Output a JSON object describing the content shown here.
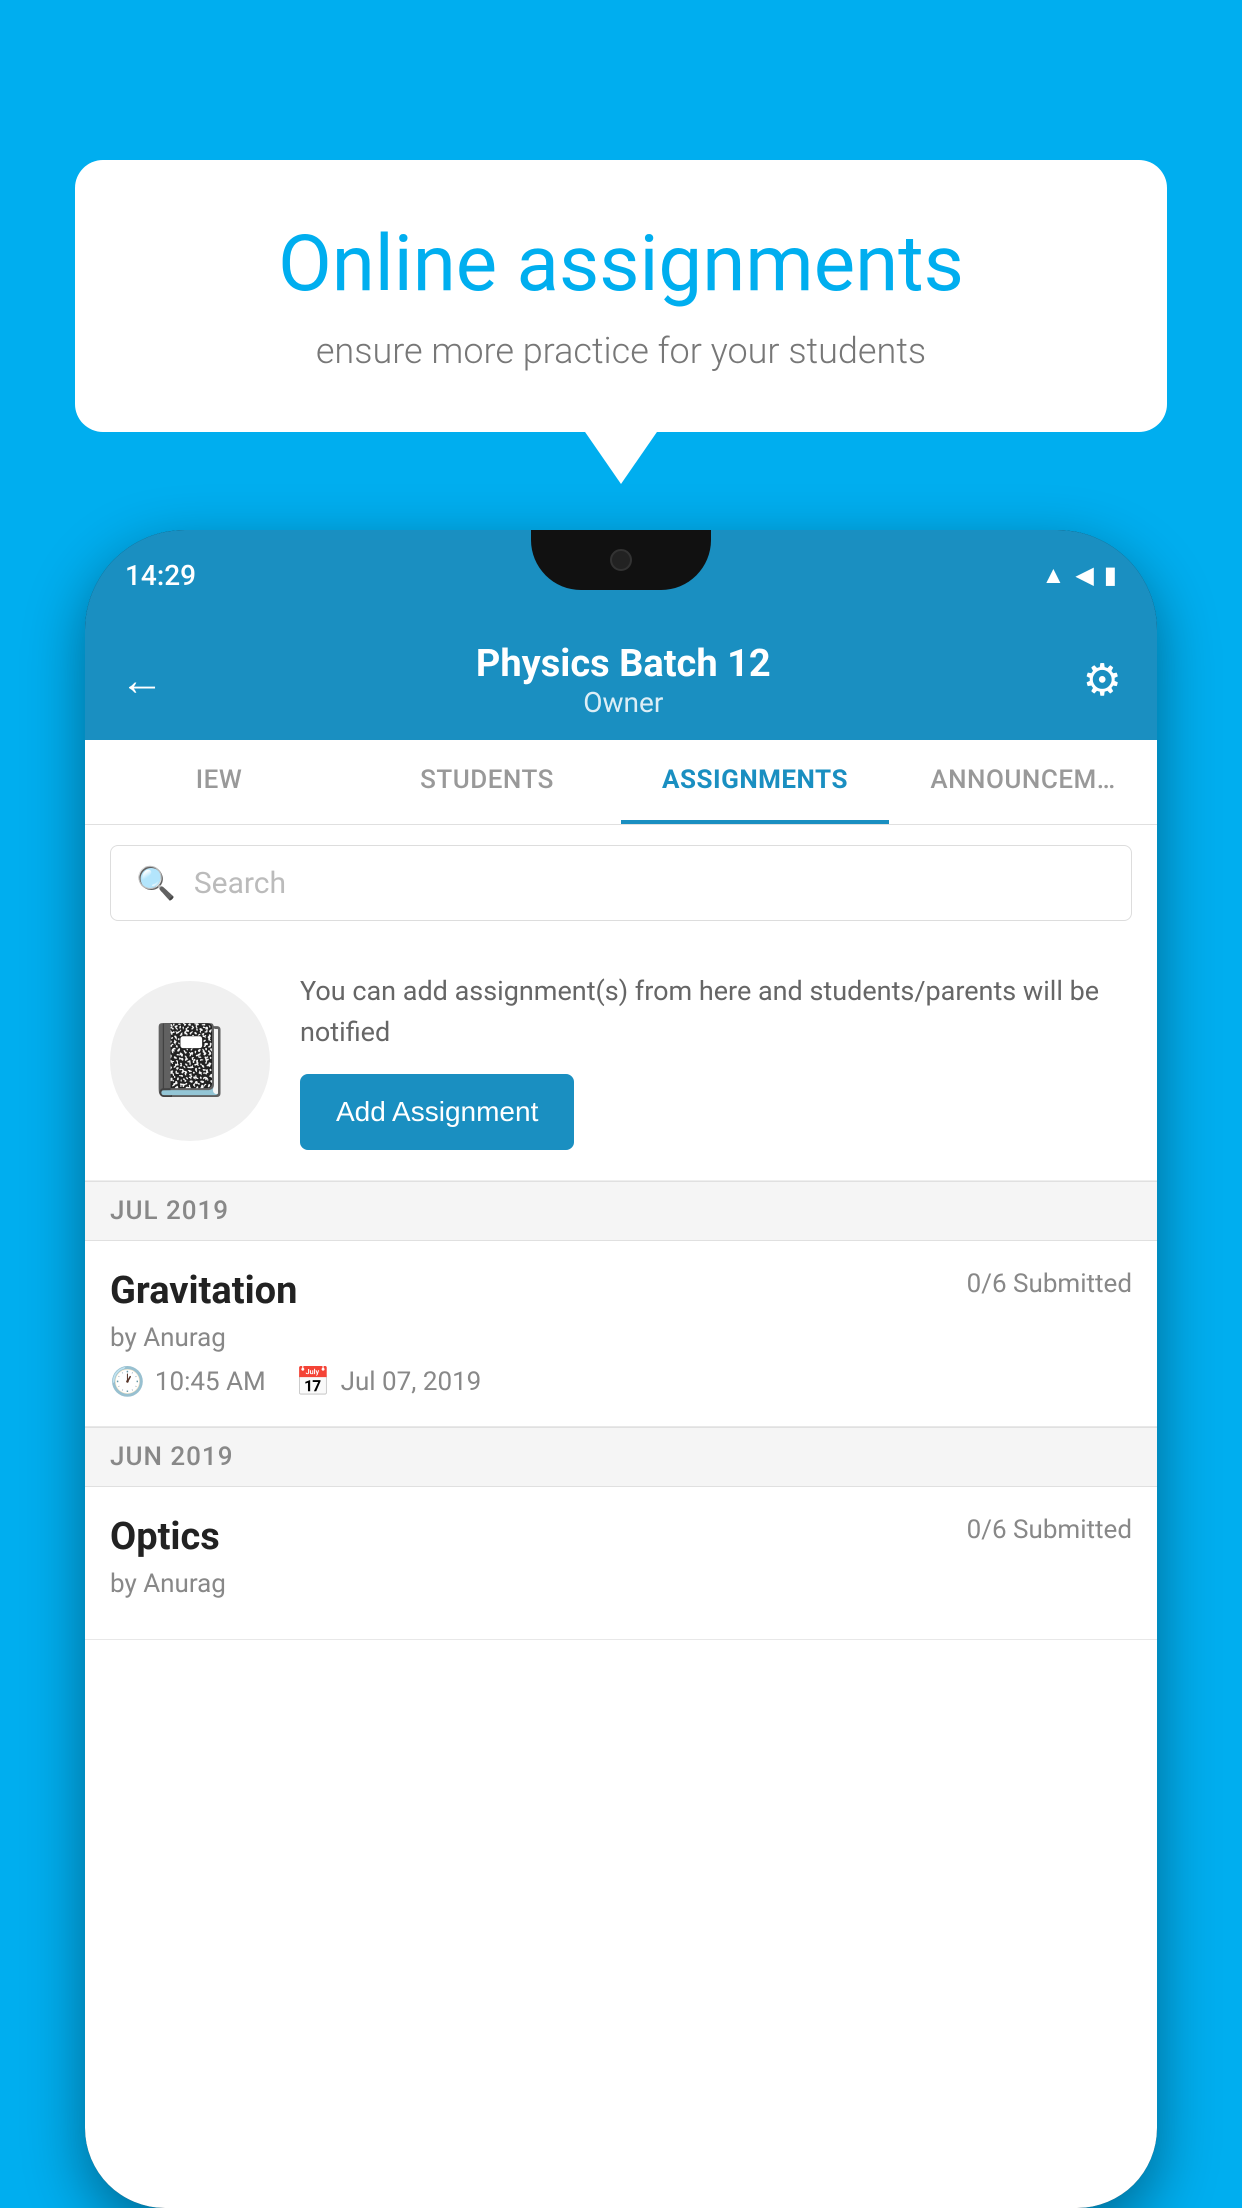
{
  "background_color": "#00AEEF",
  "speech_bubble": {
    "title": "Online assignments",
    "subtitle": "ensure more practice for your students"
  },
  "phone": {
    "time": "14:29",
    "header": {
      "title": "Physics Batch 12",
      "subtitle": "Owner",
      "back_label": "←",
      "settings_label": "⚙"
    },
    "tabs": [
      {
        "label": "IEW",
        "active": false
      },
      {
        "label": "STUDENTS",
        "active": false
      },
      {
        "label": "ASSIGNMENTS",
        "active": true
      },
      {
        "label": "ANNOUNCEM…",
        "active": false
      }
    ],
    "search": {
      "placeholder": "Search"
    },
    "promo": {
      "text": "You can add assignment(s) from here and students/parents will be notified",
      "button_label": "Add Assignment"
    },
    "sections": [
      {
        "header": "JUL 2019",
        "assignments": [
          {
            "title": "Gravitation",
            "submitted": "0/6 Submitted",
            "by": "by Anurag",
            "time": "10:45 AM",
            "date": "Jul 07, 2019"
          }
        ]
      },
      {
        "header": "JUN 2019",
        "assignments": [
          {
            "title": "Optics",
            "submitted": "0/6 Submitted",
            "by": "by Anurag",
            "time": "",
            "date": ""
          }
        ]
      }
    ]
  }
}
